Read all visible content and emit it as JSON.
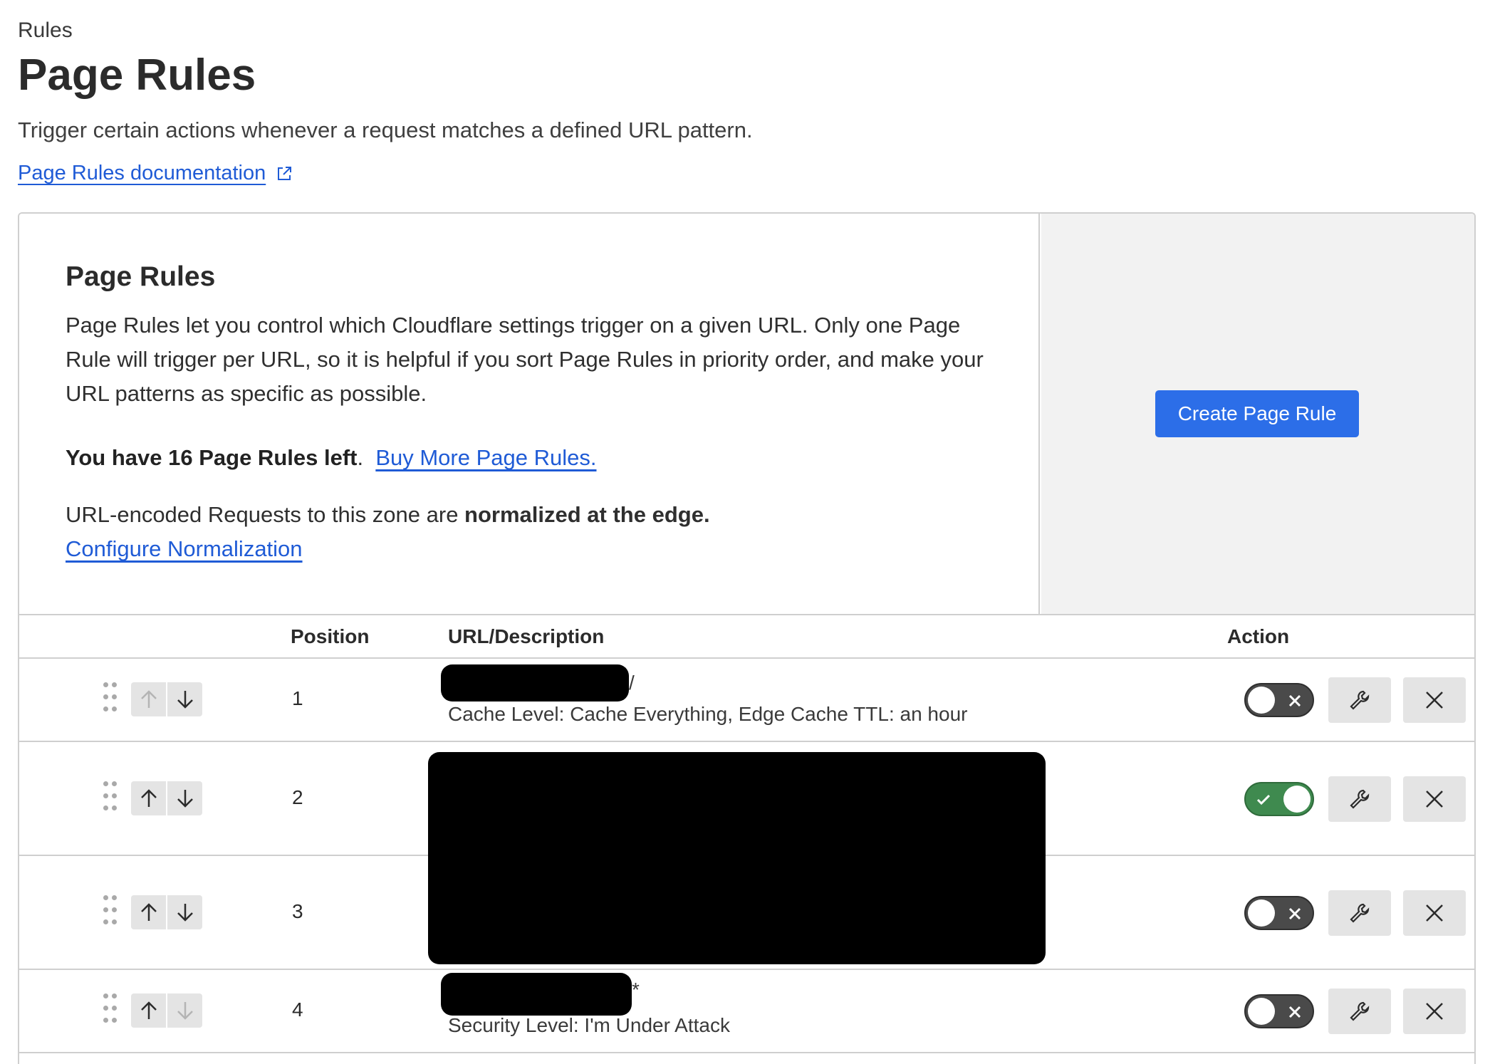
{
  "breadcrumb": "Rules",
  "page_title": "Page Rules",
  "subtitle": "Trigger certain actions whenever a request matches a defined URL pattern.",
  "doc_link": "Page Rules documentation",
  "panel": {
    "heading": "Page Rules",
    "description": "Page Rules let you control which Cloudflare settings trigger on a given URL. Only one Page Rule will trigger per URL, so it is helpful if you sort Page Rules in priority order, and make your URL patterns as specific as possible.",
    "rules_left": "You have 16 Page Rules left",
    "rules_left_period": ".",
    "buy_more": "Buy More Page Rules.",
    "normalization_prefix": "URL-encoded Requests to this zone are ",
    "normalization_bold": "normalized at the edge.",
    "configure_link": "Configure Normalization",
    "create_button": "Create Page Rule"
  },
  "table": {
    "headers": {
      "position": "Position",
      "url": "URL/Description",
      "action": "Action"
    },
    "rows": [
      {
        "position": "1",
        "url_suffix": "/",
        "description": "Cache Level: Cache Everything, Edge Cache TTL: an hour",
        "enabled": false
      },
      {
        "position": "2",
        "url_suffix": "",
        "description": "",
        "enabled": true
      },
      {
        "position": "3",
        "url_suffix": "",
        "description": "",
        "enabled": false
      },
      {
        "position": "4",
        "url_suffix": "*",
        "description": "Security Level: I'm Under Attack",
        "enabled": false
      }
    ]
  },
  "icons": {
    "external_link": "external-link-icon",
    "drag": "drag-handle-icon",
    "up": "arrow-up-icon",
    "down": "arrow-down-icon",
    "edit": "wrench-icon",
    "delete": "close-icon",
    "toggle_on": "check-icon",
    "toggle_off": "x-icon"
  },
  "colors": {
    "link": "#1f5bd6",
    "primary_button": "#2c6ee8",
    "toggle_on": "#3f8a4f",
    "toggle_off": "#4a4a4a"
  }
}
